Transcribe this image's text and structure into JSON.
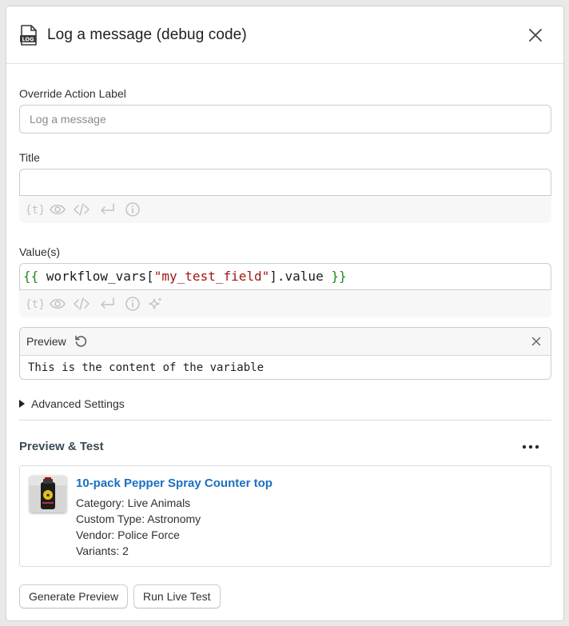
{
  "dialog": {
    "title": "Log a message (debug code)",
    "icon": "log-file-icon",
    "close_icon": "close-icon"
  },
  "form": {
    "override_label": "Override Action Label",
    "override_placeholder": "Log a message",
    "override_value": "",
    "title_label": "Title",
    "title_value": "",
    "values_label": "Value(s)",
    "values_code": {
      "open": "{{",
      "pre": " workflow_vars[",
      "string": "\"my_test_field\"",
      "post": "].value ",
      "close": "}}"
    },
    "toolbar_icons": [
      "variable-icon",
      "eye-icon",
      "code-icon",
      "return-icon",
      "info-icon",
      "sparkle-icon"
    ]
  },
  "preview": {
    "title": "Preview",
    "content": "This is the content of the variable"
  },
  "advanced": {
    "label": "Advanced Settings"
  },
  "test_section": {
    "title": "Preview & Test",
    "product": {
      "name": "10-pack Pepper Spray Counter top",
      "category": "Category: Live Animals",
      "custom_type": "Custom Type: Astronomy",
      "vendor": "Vendor: Police Force",
      "variants": "Variants: 2"
    },
    "generate_button": "Generate Preview",
    "run_button": "Run Live Test"
  },
  "colors": {
    "link": "#1a6fc2",
    "brace": "#1b8a1b",
    "string": "#a31515",
    "icon_muted": "#c2c2c2"
  }
}
